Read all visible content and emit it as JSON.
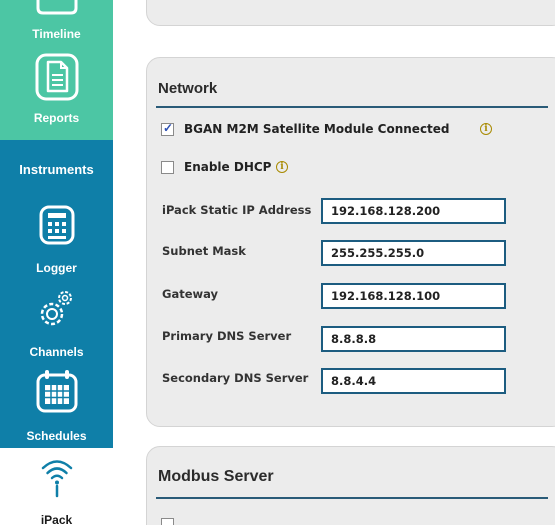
{
  "sidebar": {
    "items": [
      {
        "label": "Timeline",
        "icon": "timeline-icon"
      },
      {
        "label": "Reports",
        "icon": "document-icon"
      },
      {
        "label": "Instruments",
        "icon": ""
      },
      {
        "label": "Logger",
        "icon": "calculator-icon"
      },
      {
        "label": "Channels",
        "icon": "gears-icon"
      },
      {
        "label": "Schedules",
        "icon": "calendar-icon"
      },
      {
        "label": "iPack",
        "icon": "wifi-icon"
      }
    ],
    "colors": {
      "primary": "#4cc6a4",
      "secondary": "#0f7fa8"
    }
  },
  "network": {
    "title": "Network",
    "bgan_label": "BGAN M2M Satellite Module Connected",
    "bgan_checked": true,
    "dhcp_label": "Enable DHCP",
    "dhcp_checked": false,
    "fields": [
      {
        "label": "iPack Static IP Address",
        "value": "192.168.128.200"
      },
      {
        "label": "Subnet Mask",
        "value": "255.255.255.0"
      },
      {
        "label": "Gateway",
        "value": "192.168.128.100"
      },
      {
        "label": "Primary DNS Server",
        "value": "8.8.8.8"
      },
      {
        "label": "Secondary DNS Server",
        "value": "8.8.4.4"
      }
    ]
  },
  "modbus": {
    "title": "Modbus Server"
  }
}
